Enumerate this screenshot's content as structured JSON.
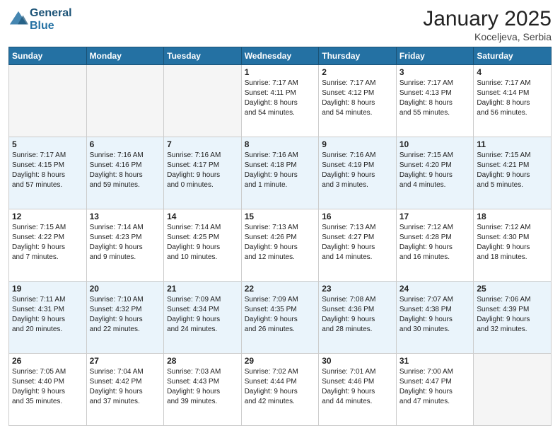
{
  "header": {
    "logo_line1": "General",
    "logo_line2": "Blue",
    "month": "January 2025",
    "location": "Koceljeva, Serbia"
  },
  "weekdays": [
    "Sunday",
    "Monday",
    "Tuesday",
    "Wednesday",
    "Thursday",
    "Friday",
    "Saturday"
  ],
  "weeks": [
    [
      {
        "day": "",
        "info": ""
      },
      {
        "day": "",
        "info": ""
      },
      {
        "day": "",
        "info": ""
      },
      {
        "day": "1",
        "info": "Sunrise: 7:17 AM\nSunset: 4:11 PM\nDaylight: 8 hours\nand 54 minutes."
      },
      {
        "day": "2",
        "info": "Sunrise: 7:17 AM\nSunset: 4:12 PM\nDaylight: 8 hours\nand 54 minutes."
      },
      {
        "day": "3",
        "info": "Sunrise: 7:17 AM\nSunset: 4:13 PM\nDaylight: 8 hours\nand 55 minutes."
      },
      {
        "day": "4",
        "info": "Sunrise: 7:17 AM\nSunset: 4:14 PM\nDaylight: 8 hours\nand 56 minutes."
      }
    ],
    [
      {
        "day": "5",
        "info": "Sunrise: 7:17 AM\nSunset: 4:15 PM\nDaylight: 8 hours\nand 57 minutes."
      },
      {
        "day": "6",
        "info": "Sunrise: 7:16 AM\nSunset: 4:16 PM\nDaylight: 8 hours\nand 59 minutes."
      },
      {
        "day": "7",
        "info": "Sunrise: 7:16 AM\nSunset: 4:17 PM\nDaylight: 9 hours\nand 0 minutes."
      },
      {
        "day": "8",
        "info": "Sunrise: 7:16 AM\nSunset: 4:18 PM\nDaylight: 9 hours\nand 1 minute."
      },
      {
        "day": "9",
        "info": "Sunrise: 7:16 AM\nSunset: 4:19 PM\nDaylight: 9 hours\nand 3 minutes."
      },
      {
        "day": "10",
        "info": "Sunrise: 7:15 AM\nSunset: 4:20 PM\nDaylight: 9 hours\nand 4 minutes."
      },
      {
        "day": "11",
        "info": "Sunrise: 7:15 AM\nSunset: 4:21 PM\nDaylight: 9 hours\nand 5 minutes."
      }
    ],
    [
      {
        "day": "12",
        "info": "Sunrise: 7:15 AM\nSunset: 4:22 PM\nDaylight: 9 hours\nand 7 minutes."
      },
      {
        "day": "13",
        "info": "Sunrise: 7:14 AM\nSunset: 4:23 PM\nDaylight: 9 hours\nand 9 minutes."
      },
      {
        "day": "14",
        "info": "Sunrise: 7:14 AM\nSunset: 4:25 PM\nDaylight: 9 hours\nand 10 minutes."
      },
      {
        "day": "15",
        "info": "Sunrise: 7:13 AM\nSunset: 4:26 PM\nDaylight: 9 hours\nand 12 minutes."
      },
      {
        "day": "16",
        "info": "Sunrise: 7:13 AM\nSunset: 4:27 PM\nDaylight: 9 hours\nand 14 minutes."
      },
      {
        "day": "17",
        "info": "Sunrise: 7:12 AM\nSunset: 4:28 PM\nDaylight: 9 hours\nand 16 minutes."
      },
      {
        "day": "18",
        "info": "Sunrise: 7:12 AM\nSunset: 4:30 PM\nDaylight: 9 hours\nand 18 minutes."
      }
    ],
    [
      {
        "day": "19",
        "info": "Sunrise: 7:11 AM\nSunset: 4:31 PM\nDaylight: 9 hours\nand 20 minutes."
      },
      {
        "day": "20",
        "info": "Sunrise: 7:10 AM\nSunset: 4:32 PM\nDaylight: 9 hours\nand 22 minutes."
      },
      {
        "day": "21",
        "info": "Sunrise: 7:09 AM\nSunset: 4:34 PM\nDaylight: 9 hours\nand 24 minutes."
      },
      {
        "day": "22",
        "info": "Sunrise: 7:09 AM\nSunset: 4:35 PM\nDaylight: 9 hours\nand 26 minutes."
      },
      {
        "day": "23",
        "info": "Sunrise: 7:08 AM\nSunset: 4:36 PM\nDaylight: 9 hours\nand 28 minutes."
      },
      {
        "day": "24",
        "info": "Sunrise: 7:07 AM\nSunset: 4:38 PM\nDaylight: 9 hours\nand 30 minutes."
      },
      {
        "day": "25",
        "info": "Sunrise: 7:06 AM\nSunset: 4:39 PM\nDaylight: 9 hours\nand 32 minutes."
      }
    ],
    [
      {
        "day": "26",
        "info": "Sunrise: 7:05 AM\nSunset: 4:40 PM\nDaylight: 9 hours\nand 35 minutes."
      },
      {
        "day": "27",
        "info": "Sunrise: 7:04 AM\nSunset: 4:42 PM\nDaylight: 9 hours\nand 37 minutes."
      },
      {
        "day": "28",
        "info": "Sunrise: 7:03 AM\nSunset: 4:43 PM\nDaylight: 9 hours\nand 39 minutes."
      },
      {
        "day": "29",
        "info": "Sunrise: 7:02 AM\nSunset: 4:44 PM\nDaylight: 9 hours\nand 42 minutes."
      },
      {
        "day": "30",
        "info": "Sunrise: 7:01 AM\nSunset: 4:46 PM\nDaylight: 9 hours\nand 44 minutes."
      },
      {
        "day": "31",
        "info": "Sunrise: 7:00 AM\nSunset: 4:47 PM\nDaylight: 9 hours\nand 47 minutes."
      },
      {
        "day": "",
        "info": ""
      }
    ]
  ]
}
